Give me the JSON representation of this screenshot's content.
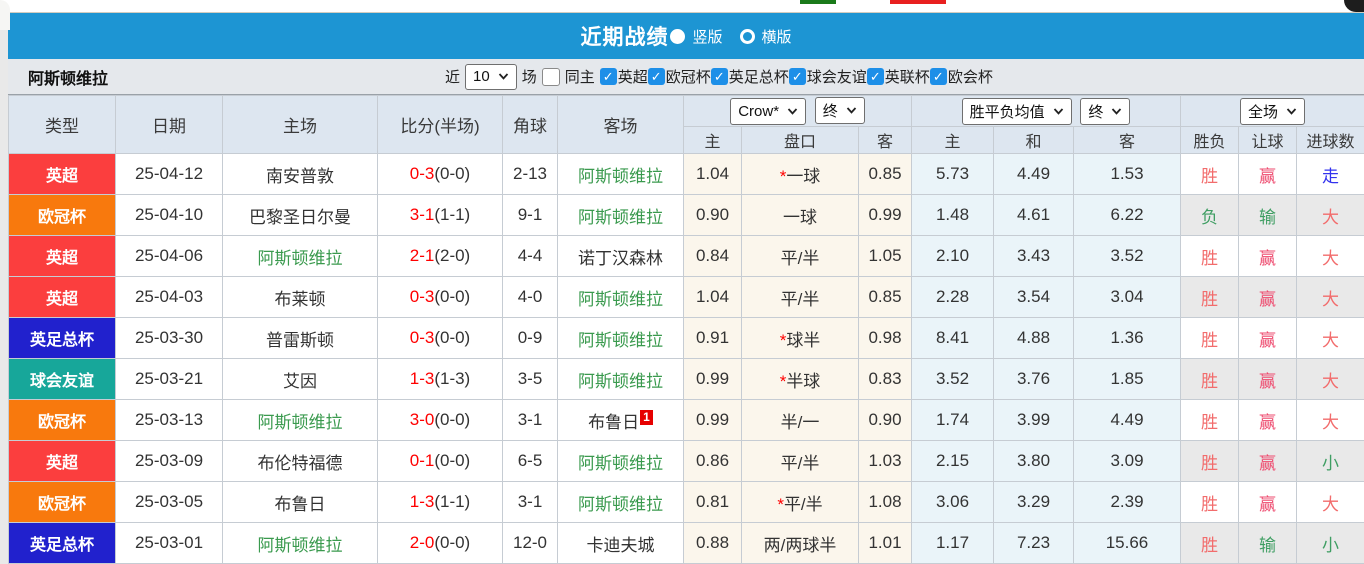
{
  "colors": {
    "accent_blue": "#1d95d3",
    "checkbox_blue": "#1d8fe8",
    "header_bg": "#dde6f0",
    "score_red": "#ff0000",
    "team_green": "#3a9a4e",
    "league_colors": {
      "英超": "#fb3e3e",
      "欧冠杯": "#f8790d",
      "英足总杯": "#2121cd",
      "球会友谊": "#17a79a"
    },
    "value_colors": {
      "red": "#f26c6c",
      "crimson": "#ee4a6e",
      "green": "#3f9e63",
      "blue": "#3333ee"
    }
  },
  "titlebar": {
    "title": "近期战绩",
    "radio_vertical": "竖版",
    "radio_horizontal": "横版"
  },
  "filter": {
    "team": "阿斯顿维拉",
    "recent_label": "近",
    "recent_value": "10",
    "matches_label": "场",
    "same_home_label": "同主",
    "leagues": [
      "英超",
      "欧冠杯",
      "英足总杯",
      "球会友谊",
      "英联杯",
      "欧会杯"
    ]
  },
  "table": {
    "selects": {
      "company": "Crow*",
      "company_time": "终",
      "mean": "胜平负均值",
      "mean_time": "终",
      "scope": "全场"
    },
    "headers": {
      "type": "类型",
      "date": "日期",
      "home": "主场",
      "score": "比分(半场)",
      "corner": "角球",
      "away": "客场",
      "odds_home": "主",
      "odds_handicap": "盘口",
      "odds_away": "客",
      "mean_home": "主",
      "mean_draw": "和",
      "mean_away": "客",
      "result": "胜负",
      "handicap_result": "让球",
      "goals": "进球数"
    },
    "rows": [
      {
        "league": "英超",
        "date": "25-04-12",
        "home": {
          "name": "南安普敦",
          "self": false
        },
        "score": {
          "ft": "0-3",
          "ht": "(0-0)"
        },
        "corners": "2-13",
        "away": {
          "name": "阿斯顿维拉",
          "self": true
        },
        "odds": {
          "home": "1.04",
          "handicap": "*一球",
          "away": "0.85"
        },
        "mean": {
          "home": "5.73",
          "draw": "4.49",
          "away": "1.53"
        },
        "outcome": {
          "result": "胜",
          "result_color": "red",
          "handicap": "赢",
          "handicap_color": "crimson",
          "goals": "走",
          "goals_color": "blue"
        }
      },
      {
        "league": "欧冠杯",
        "date": "25-04-10",
        "home": {
          "name": "巴黎圣日尔曼",
          "self": false
        },
        "score": {
          "ft": "3-1",
          "ht": "(1-1)"
        },
        "corners": "9-1",
        "away": {
          "name": "阿斯顿维拉",
          "self": true
        },
        "odds": {
          "home": "0.90",
          "handicap": "一球",
          "away": "0.99"
        },
        "mean": {
          "home": "1.48",
          "draw": "4.61",
          "away": "6.22"
        },
        "outcome": {
          "result": "负",
          "result_color": "green",
          "handicap": "输",
          "handicap_color": "green",
          "goals": "大",
          "goals_color": "red"
        }
      },
      {
        "league": "英超",
        "date": "25-04-06",
        "home": {
          "name": "阿斯顿维拉",
          "self": true
        },
        "score": {
          "ft": "2-1",
          "ht": "(2-0)"
        },
        "corners": "4-4",
        "away": {
          "name": "诺丁汉森林",
          "self": false
        },
        "odds": {
          "home": "0.84",
          "handicap": "平/半",
          "away": "1.05"
        },
        "mean": {
          "home": "2.10",
          "draw": "3.43",
          "away": "3.52"
        },
        "outcome": {
          "result": "胜",
          "result_color": "red",
          "handicap": "赢",
          "handicap_color": "crimson",
          "goals": "大",
          "goals_color": "red"
        }
      },
      {
        "league": "英超",
        "date": "25-04-03",
        "home": {
          "name": "布莱顿",
          "self": false
        },
        "score": {
          "ft": "0-3",
          "ht": "(0-0)"
        },
        "corners": "4-0",
        "away": {
          "name": "阿斯顿维拉",
          "self": true
        },
        "odds": {
          "home": "1.04",
          "handicap": "平/半",
          "away": "0.85"
        },
        "mean": {
          "home": "2.28",
          "draw": "3.54",
          "away": "3.04"
        },
        "outcome": {
          "result": "胜",
          "result_color": "red",
          "handicap": "赢",
          "handicap_color": "crimson",
          "goals": "大",
          "goals_color": "red"
        }
      },
      {
        "league": "英足总杯",
        "date": "25-03-30",
        "home": {
          "name": "普雷斯顿",
          "self": false
        },
        "score": {
          "ft": "0-3",
          "ht": "(0-0)"
        },
        "corners": "0-9",
        "away": {
          "name": "阿斯顿维拉",
          "self": true
        },
        "odds": {
          "home": "0.91",
          "handicap": "*球半",
          "away": "0.98"
        },
        "mean": {
          "home": "8.41",
          "draw": "4.88",
          "away": "1.36"
        },
        "outcome": {
          "result": "胜",
          "result_color": "red",
          "handicap": "赢",
          "handicap_color": "crimson",
          "goals": "大",
          "goals_color": "red"
        }
      },
      {
        "league": "球会友谊",
        "date": "25-03-21",
        "home": {
          "name": "艾因",
          "self": false
        },
        "score": {
          "ft": "1-3",
          "ht": "(1-3)"
        },
        "corners": "3-5",
        "away": {
          "name": "阿斯顿维拉",
          "self": true
        },
        "odds": {
          "home": "0.99",
          "handicap": "*半球",
          "away": "0.83"
        },
        "mean": {
          "home": "3.52",
          "draw": "3.76",
          "away": "1.85"
        },
        "outcome": {
          "result": "胜",
          "result_color": "red",
          "handicap": "赢",
          "handicap_color": "crimson",
          "goals": "大",
          "goals_color": "red"
        }
      },
      {
        "league": "欧冠杯",
        "date": "25-03-13",
        "home": {
          "name": "阿斯顿维拉",
          "self": true
        },
        "score": {
          "ft": "3-0",
          "ht": "(0-0)"
        },
        "corners": "3-1",
        "away": {
          "name": "布鲁日",
          "self": false,
          "sup": "1"
        },
        "odds": {
          "home": "0.99",
          "handicap": "半/一",
          "away": "0.90"
        },
        "mean": {
          "home": "1.74",
          "draw": "3.99",
          "away": "4.49"
        },
        "outcome": {
          "result": "胜",
          "result_color": "red",
          "handicap": "赢",
          "handicap_color": "crimson",
          "goals": "大",
          "goals_color": "red"
        }
      },
      {
        "league": "英超",
        "date": "25-03-09",
        "home": {
          "name": "布伦特福德",
          "self": false
        },
        "score": {
          "ft": "0-1",
          "ht": "(0-0)"
        },
        "corners": "6-5",
        "away": {
          "name": "阿斯顿维拉",
          "self": true
        },
        "odds": {
          "home": "0.86",
          "handicap": "平/半",
          "away": "1.03"
        },
        "mean": {
          "home": "2.15",
          "draw": "3.80",
          "away": "3.09"
        },
        "outcome": {
          "result": "胜",
          "result_color": "red",
          "handicap": "赢",
          "handicap_color": "crimson",
          "goals": "小",
          "goals_color": "green"
        }
      },
      {
        "league": "欧冠杯",
        "date": "25-03-05",
        "home": {
          "name": "布鲁日",
          "self": false
        },
        "score": {
          "ft": "1-3",
          "ht": "(1-1)"
        },
        "corners": "3-1",
        "away": {
          "name": "阿斯顿维拉",
          "self": true
        },
        "odds": {
          "home": "0.81",
          "handicap": "*平/半",
          "away": "1.08"
        },
        "mean": {
          "home": "3.06",
          "draw": "3.29",
          "away": "2.39"
        },
        "outcome": {
          "result": "胜",
          "result_color": "red",
          "handicap": "赢",
          "handicap_color": "crimson",
          "goals": "大",
          "goals_color": "red"
        }
      },
      {
        "league": "英足总杯",
        "date": "25-03-01",
        "home": {
          "name": "阿斯顿维拉",
          "self": true
        },
        "score": {
          "ft": "2-0",
          "ht": "(0-0)"
        },
        "corners": "12-0",
        "away": {
          "name": "卡迪夫城",
          "self": false
        },
        "odds": {
          "home": "0.88",
          "handicap": "两/两球半",
          "away": "1.01"
        },
        "mean": {
          "home": "1.17",
          "draw": "7.23",
          "away": "15.66"
        },
        "outcome": {
          "result": "胜",
          "result_color": "red",
          "handicap": "输",
          "handicap_color": "green",
          "goals": "小",
          "goals_color": "green"
        }
      }
    ]
  }
}
